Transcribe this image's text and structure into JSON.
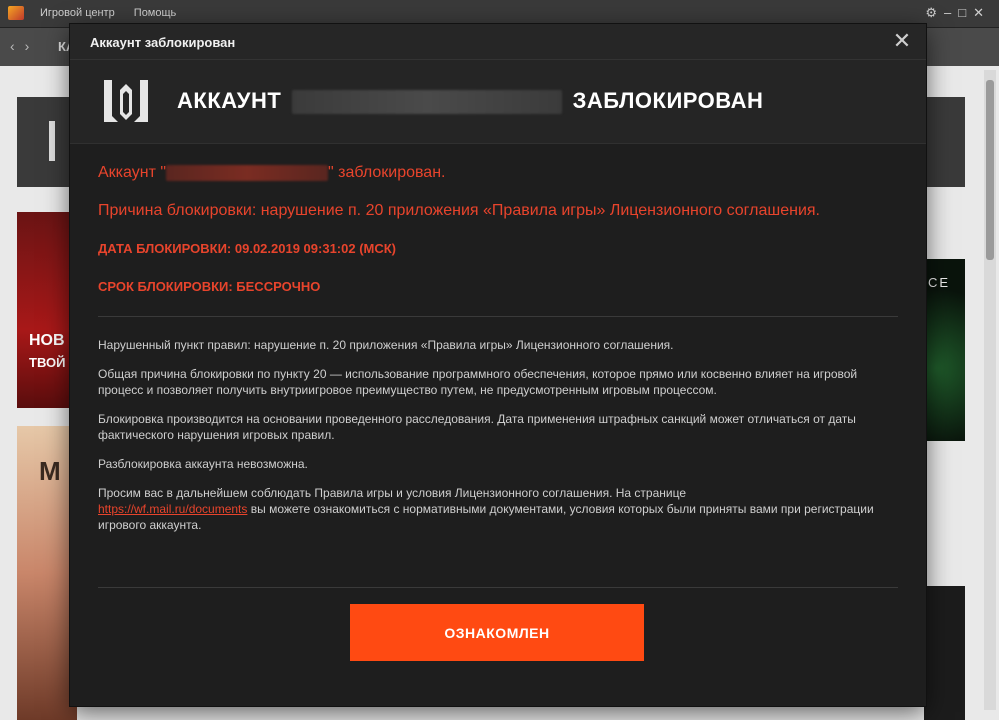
{
  "app": {
    "menu": [
      "Игровой центр",
      "Помощь"
    ],
    "nav_text": "КА",
    "tile_red_line1": "НОВ",
    "tile_red_line2": "ТВОЙ",
    "tile_orange_text": "M",
    "tile_green_text": "CE"
  },
  "modal": {
    "title": "Аккаунт заблокирован",
    "close_icon": "close-icon",
    "heading_prefix": "АККАУНТ",
    "heading_suffix": "ЗАБЛОКИРОВАН",
    "line1_prefix": "Аккаунт \"",
    "line1_suffix": "\" заблокирован.",
    "reason": "Причина блокировки: нарушение п. 20 приложения «Правила игры» Лицензионного соглашения.",
    "block_date": "ДАТА БЛОКИРОВКИ: 09.02.2019 09:31:02 (МСК)",
    "block_term": "СРОК БЛОКИРОВКИ: БЕССРОЧНО",
    "info": {
      "p1": "Нарушенный пункт правил: нарушение п. 20 приложения «Правила игры» Лицензионного соглашения.",
      "p2": "Общая причина блокировки по пункту 20 — использование программного обеспечения, которое прямо или косвенно влияет на игровой процесс и позволяет получить внутриигровое преимущество путем, не предусмотренным игровым процессом.",
      "p3": "Блокировка производится на основании проведенного расследования. Дата применения штрафных санкций может отличаться от даты фактического нарушения игровых правил.",
      "p4": "Разблокировка аккаунта невозможна.",
      "p5_prefix": "Просим вас в дальнейшем соблюдать Правила игры и условия Лицензионного соглашения. На странице",
      "p5_link": "https://wf.mail.ru/documents",
      "p5_suffix": "вы можете ознакомиться с нормативными документами, условия которых были приняты вами при регистрации игрового аккаунта."
    },
    "ack_button": "ОЗНАКОМЛЕН"
  },
  "colors": {
    "accent_red": "#e8442c",
    "button_orange": "#ff4a12",
    "modal_bg": "#1e1e1e"
  }
}
